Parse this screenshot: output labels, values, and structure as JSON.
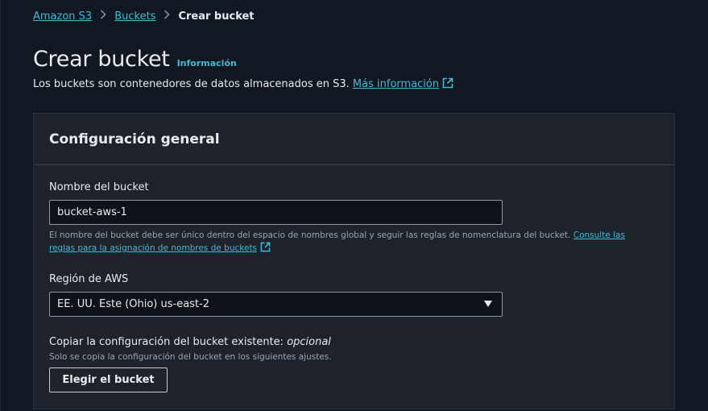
{
  "breadcrumb": {
    "items": [
      {
        "label": "Amazon S3"
      },
      {
        "label": "Buckets"
      }
    ],
    "current": "Crear bucket"
  },
  "header": {
    "title": "Crear bucket",
    "info_link": "Información",
    "description": "Los buckets son contenedores de datos almacenados en S3.",
    "more_info_link": "Más información",
    "more_info_icon": "external-link-icon"
  },
  "general_config": {
    "title": "Configuración general",
    "bucket_name": {
      "label": "Nombre del bucket",
      "value": "bucket-aws-1",
      "help_text": "El nombre del bucket debe ser único dentro del espacio de nombres global y seguir las reglas de nomenclatura del bucket.",
      "help_link": "Consulte las reglas para la asignación de nombres de buckets"
    },
    "region": {
      "label": "Región de AWS",
      "selected": "EE. UU. Este (Ohio) us-east-2"
    },
    "copy_settings": {
      "label": "Copiar la configuración del bucket existente:",
      "optional": "opcional",
      "help_text": "Solo se copia la configuración del bucket en los siguientes ajustes.",
      "button_label": "Elegir el bucket"
    }
  },
  "colors": {
    "background": "#111822",
    "panel": "#1e232b",
    "link": "#44b9d6",
    "text": "#e9ebed"
  }
}
